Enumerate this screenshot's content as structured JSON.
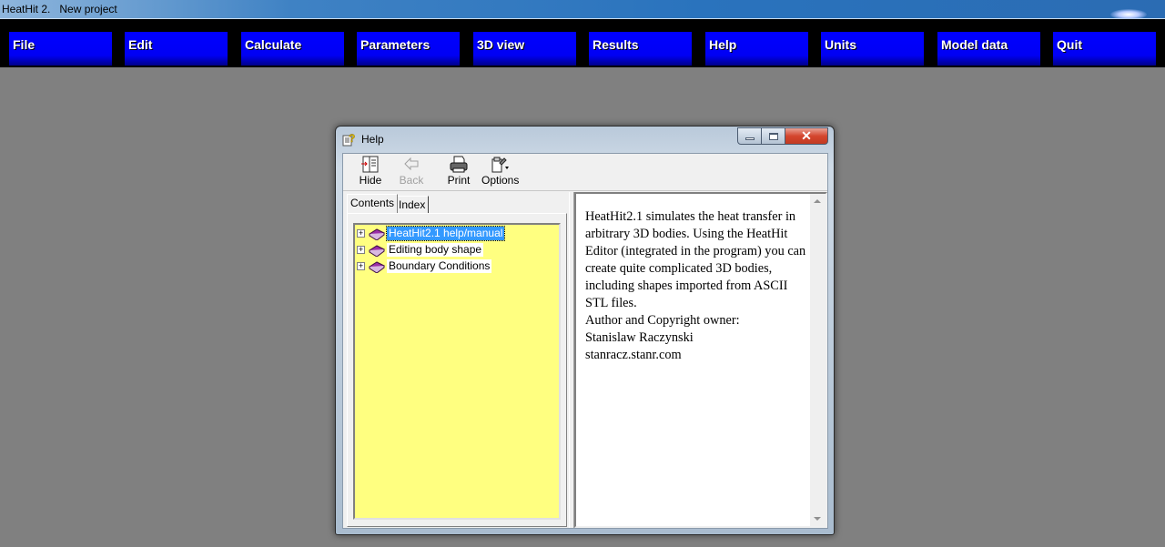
{
  "app": {
    "title": "HeatHit 2.   New project"
  },
  "menu": [
    {
      "label": "File"
    },
    {
      "label": "Edit"
    },
    {
      "label": "Calculate"
    },
    {
      "label": "Parameters"
    },
    {
      "label": "3D view"
    },
    {
      "label": "Results"
    },
    {
      "label": "Help"
    },
    {
      "label": "Units"
    },
    {
      "label": "Model data"
    },
    {
      "label": "Quit"
    }
  ],
  "help_window": {
    "title": "Help",
    "icon": "help-book-question-icon",
    "caption": {
      "minimize": "minimize-icon",
      "maximize": "maximize-icon",
      "close": "close-icon",
      "close_glyph": "✕"
    },
    "toolbar": {
      "hide": {
        "label": "Hide",
        "icon": "hide-pane-icon"
      },
      "back": {
        "label": "Back",
        "icon": "back-arrow-icon",
        "disabled": true
      },
      "print": {
        "label": "Print",
        "icon": "printer-icon"
      },
      "options": {
        "label": "Options",
        "icon": "options-icon"
      }
    },
    "tabs": {
      "contents": "Contents",
      "index": "Index",
      "active": "Contents"
    },
    "tree": [
      {
        "label": "HeatHit2.1 help/manual",
        "selected": true,
        "expander": "+",
        "icon": "book-icon"
      },
      {
        "label": "Editing body shape",
        "selected": false,
        "expander": "+",
        "icon": "book-icon"
      },
      {
        "label": "Boundary Conditions",
        "selected": false,
        "expander": "+",
        "icon": "book-icon"
      }
    ],
    "content": {
      "paragraph": "HeatHit2.1 simulates the heat transfer in arbitrary 3D bodies. Using the HeatHit Editor (integrated in the program) you can create quite complicated 3D bodies, including shapes imported from ASCII STL files.",
      "author_line": "Author and Copyright owner:",
      "author": "Stanislaw Raczynski",
      "website": "stanracz.stanr.com"
    }
  },
  "colors": {
    "menu_button": "#0000ff",
    "menubar_bg": "#000000",
    "desktop": "#808080",
    "tree_bg": "#ffff80",
    "selection": "#3399ff"
  }
}
